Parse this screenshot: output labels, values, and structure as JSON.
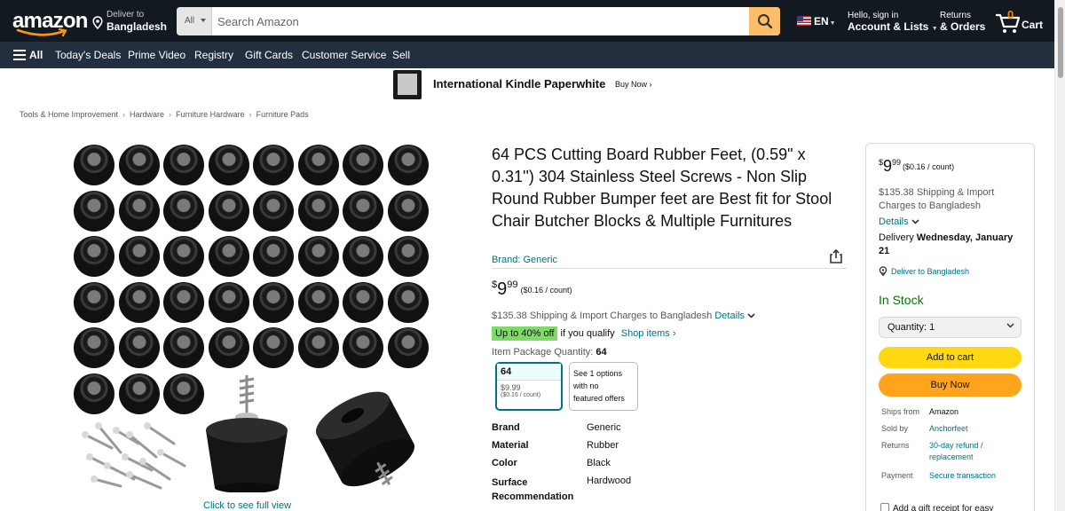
{
  "header": {
    "logo_text": "amazon",
    "deliver_line1": "Deliver to",
    "deliver_line2": "Bangladesh",
    "search_category": "All",
    "search_placeholder": "Search Amazon",
    "language": "EN",
    "account_line1": "Hello, sign in",
    "account_line2": "Account & Lists",
    "returns_line1": "Returns",
    "returns_line2": "& Orders",
    "cart_count": "0",
    "cart_label": "Cart"
  },
  "subnav": {
    "all_label": "All",
    "items": [
      "Today's Deals",
      "Prime Video",
      "Registry",
      "Gift Cards",
      "Customer Service",
      "Sell"
    ]
  },
  "banner": {
    "title": "International Kindle Paperwhite",
    "cta": "Buy Now ›"
  },
  "breadcrumb": [
    "Tools & Home Improvement",
    "Hardware",
    "Furniture Hardware",
    "Furniture Pads"
  ],
  "gallery": {
    "see_full": "Click to see full view"
  },
  "product": {
    "title": "64 PCS Cutting Board Rubber Feet, (0.59\" x 0.31'') 304 Stainless Steel Screws - Non Slip Round Rubber Bumper feet are Best fit for Stool Chair Butcher Blocks & Multiple Furnitures",
    "brand": "Brand: Generic",
    "price_symbol": "$",
    "price_whole": "9",
    "price_fraction": "99",
    "price_unit": "($0.16 / count)",
    "shipping": "$135.38 Shipping & Import Charges to Bangladesh",
    "shipping_details": "Details",
    "deal_badge": "Up to 40% off",
    "deal_text": "if you qualify",
    "deal_link": "Shop items ›",
    "package_label": "Item Package Quantity:",
    "package_value": "64",
    "option1_title": "64",
    "option1_price": "$9.99",
    "option1_unit": "($0.16 / count)",
    "option2_line1": "See 1 options",
    "option2_line2": "with no",
    "option2_line3": "featured offers",
    "specs": [
      {
        "k": "Brand",
        "v": "Generic"
      },
      {
        "k": "Material",
        "v": "Rubber"
      },
      {
        "k": "Color",
        "v": "Black"
      },
      {
        "k": "Surface",
        "v": "Hardwood"
      }
    ],
    "spec_surface_k2": "Recommendation"
  },
  "buybox": {
    "price_symbol": "$",
    "price_whole": "9",
    "price_fraction": "99",
    "price_unit": "($0.16 / count)",
    "shipping": "$135.38 Shipping & Import Charges to Bangladesh",
    "details": "Details",
    "delivery_prefix": "Delivery",
    "delivery_date": "Wednesday, January 21",
    "deliver_to": "Deliver to Bangladesh",
    "stock": "In Stock",
    "quantity": "Quantity: 1",
    "add_to_cart": "Add to cart",
    "buy_now": "Buy Now",
    "info": [
      {
        "k": "Ships from",
        "v": "Amazon",
        "link": false
      },
      {
        "k": "Sold by",
        "v": "Anchorfeet",
        "link": true
      },
      {
        "k": "Returns",
        "v": "30-day refund /",
        "link": true
      },
      {
        "k": "",
        "v": "replacement",
        "link": true
      },
      {
        "k": "Payment",
        "v": "Secure transaction",
        "link": true
      }
    ],
    "gift": "Add a gift receipt for easy"
  },
  "colors": {
    "nav_dark": "#131921",
    "nav_sub": "#232f3e",
    "search_button": "#febd69",
    "add_to_cart": "#ffd814",
    "buy_now": "#ffa41c",
    "link": "#007185",
    "in_stock": "#007600",
    "deal_badge": "#7fda69"
  }
}
